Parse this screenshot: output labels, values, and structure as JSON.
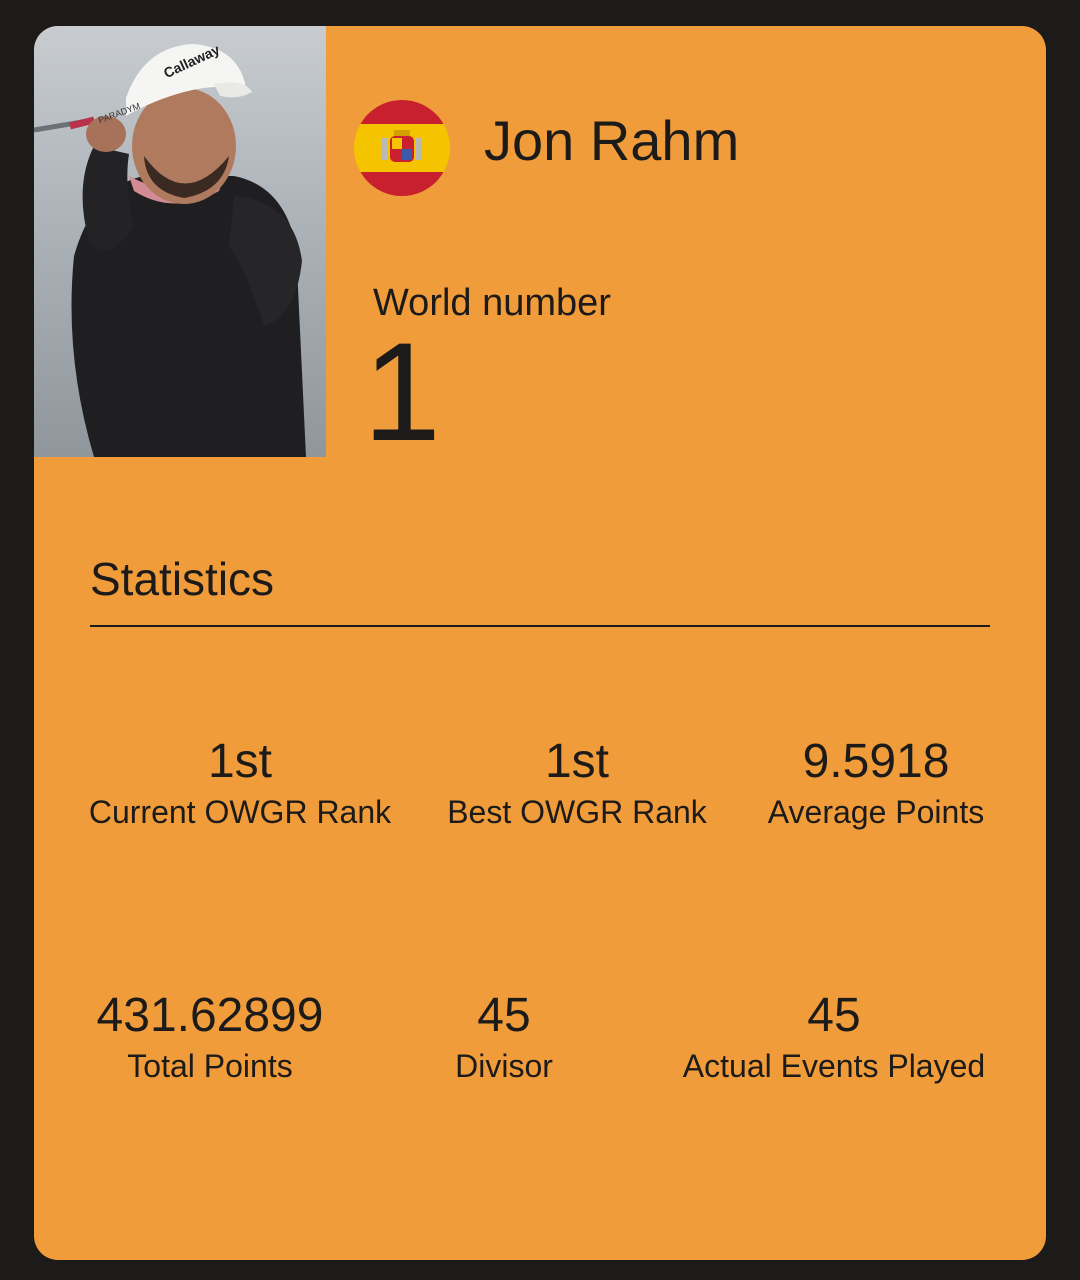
{
  "player": {
    "name": "Jon Rahm",
    "world_number_label": "World number",
    "world_number": "1"
  },
  "statistics": {
    "title": "Statistics",
    "items": [
      {
        "value": "1st",
        "label": "Current OWGR Rank"
      },
      {
        "value": "1st",
        "label": "Best OWGR Rank"
      },
      {
        "value": "9.5918",
        "label": "Average Points"
      },
      {
        "value": "431.62899",
        "label": "Total Points"
      },
      {
        "value": "45",
        "label": "Divisor"
      },
      {
        "value": "45",
        "label": "Actual Events Played"
      }
    ]
  },
  "colors": {
    "card_background": "#f09c3a",
    "page_background": "#1c1b1a",
    "text": "#1d1b1a"
  },
  "icons": {
    "flag": "spain-flag-icon",
    "photo": "player-photo"
  }
}
